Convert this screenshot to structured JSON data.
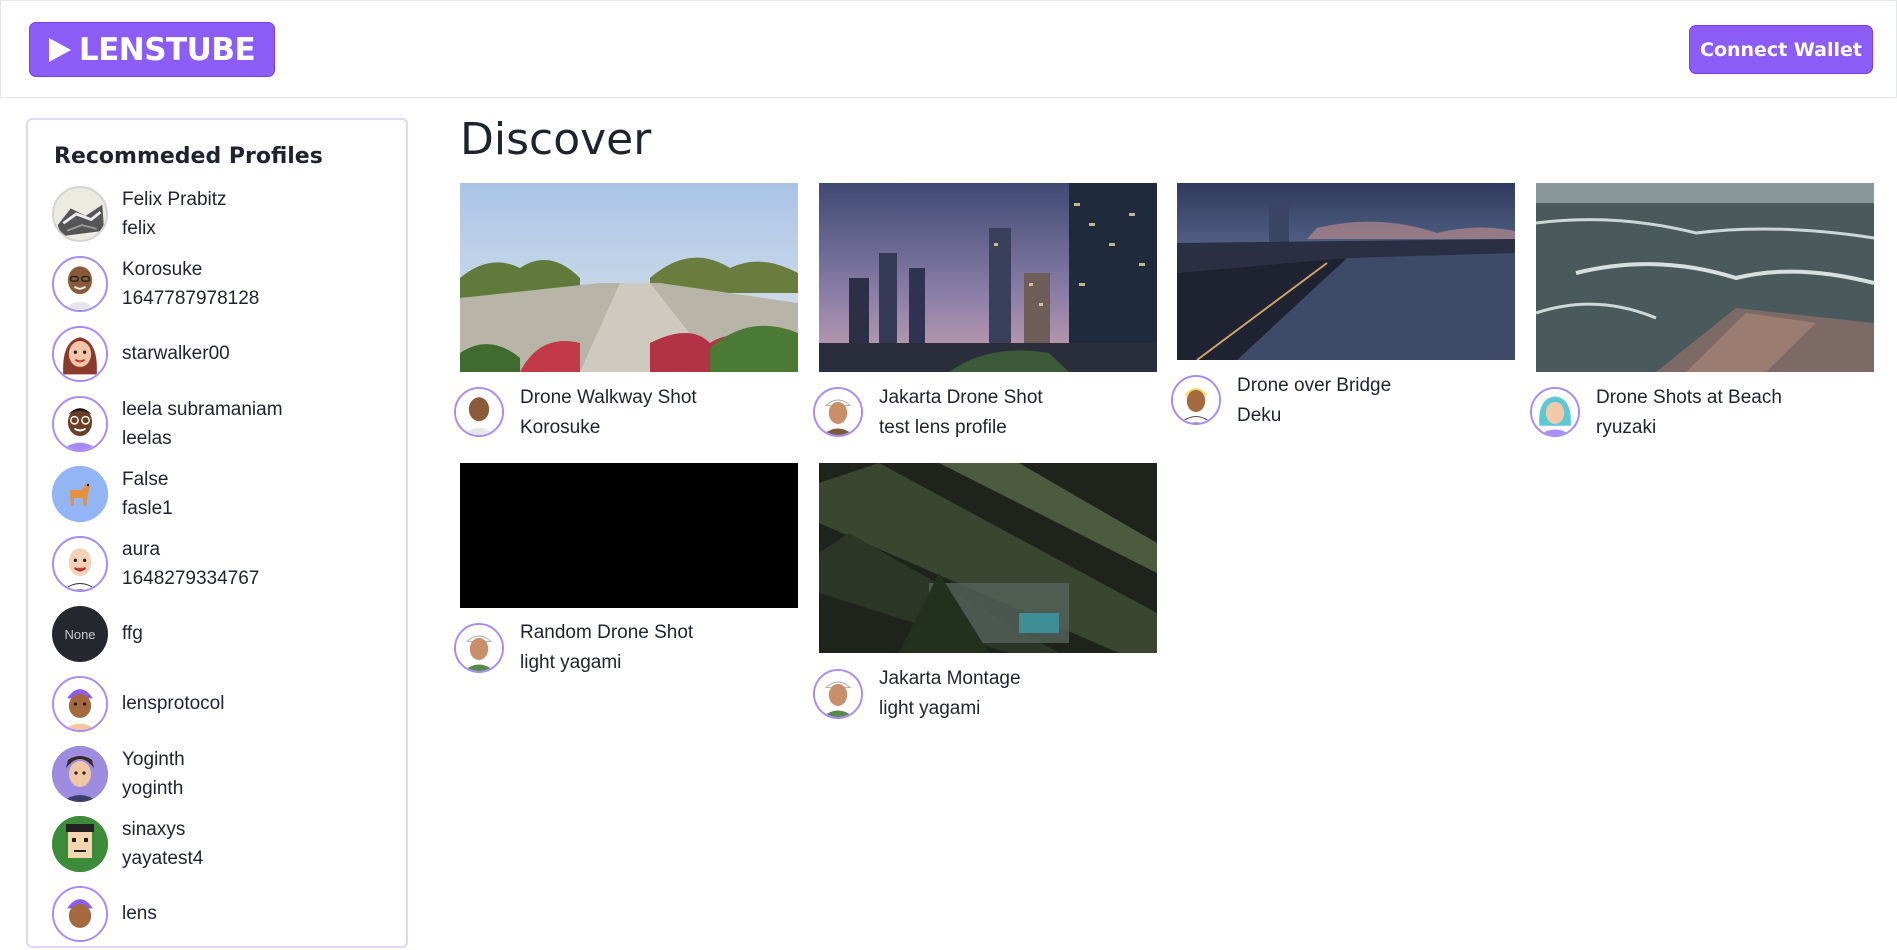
{
  "header": {
    "logo_text": "LENSTUBE",
    "connect_label": "Connect Wallet",
    "accent_color": "#8b5cf6"
  },
  "sidebar": {
    "title": "Recommeded Profiles",
    "profiles": [
      {
        "name": "Felix Prabitz",
        "handle": "felix"
      },
      {
        "name": "Korosuke",
        "handle": "1647787978128"
      },
      {
        "name": "starwalker00",
        "handle": ""
      },
      {
        "name": "leela subramaniam",
        "handle": "leelas"
      },
      {
        "name": "False",
        "handle": "fasle1"
      },
      {
        "name": "aura",
        "handle": "1648279334767"
      },
      {
        "name": "ffg",
        "handle": "",
        "avatar_text": "None"
      },
      {
        "name": "lensprotocol",
        "handle": ""
      },
      {
        "name": "Yoginth",
        "handle": "yoginth"
      },
      {
        "name": "sinaxys",
        "handle": "yayatest4"
      },
      {
        "name": "lens",
        "handle": ""
      }
    ]
  },
  "main": {
    "title": "Discover",
    "videos": [
      {
        "title": "Drone Walkway Shot",
        "author": "Korosuke"
      },
      {
        "title": "Jakarta Drone Shot",
        "author": "test lens profile"
      },
      {
        "title": "Drone over Bridge",
        "author": "Deku"
      },
      {
        "title": "Drone Shots at Beach",
        "author": "ryuzaki"
      },
      {
        "title": "Random Drone Shot",
        "author": "light yagami"
      },
      {
        "title": "Jakarta Montage",
        "author": "light yagami"
      }
    ]
  }
}
